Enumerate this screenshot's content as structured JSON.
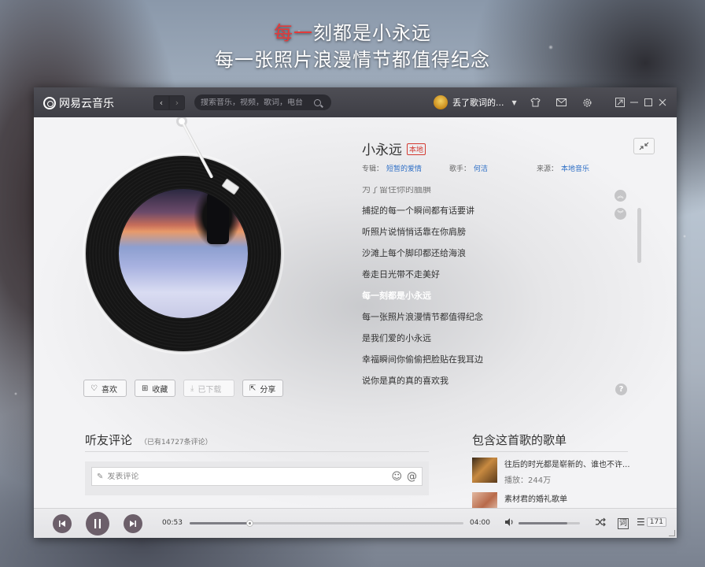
{
  "desktop_lyrics": {
    "line1_highlight": "每一",
    "line1_rest": "刻都是小永远",
    "line2": "每一张照片浪漫情节都值得纪念"
  },
  "titlebar": {
    "app_name": "网易云音乐",
    "back_icon": "‹",
    "forward_icon": "›",
    "search_placeholder": "搜索音乐，视频，歌词，电台",
    "user_name": "丢了歌词的...",
    "caret": "▼"
  },
  "song": {
    "title": "小永远",
    "badge": "本地",
    "album_label": "专辑：",
    "album": "短暂的爱情",
    "artist_label": "歌手：",
    "artist": "何洁",
    "source_label": "来源：",
    "source": "本地音乐"
  },
  "lyrics": {
    "lines": [
      "为了留住你的腼腆",
      "捕捉的每一个瞬间都有话要讲",
      "听照片说悄悄话靠在你肩膀",
      "沙滩上每个脚印都还给海浪",
      "卷走日光带不走美好",
      "每一刻都是小永远",
      "每一张照片浪漫情节都值得纪念",
      "是我们爱的小永远",
      "幸福瞬间你偷偷把脸贴在我耳边",
      "说你是真的真的喜欢我"
    ],
    "active_index": 5,
    "help": "?"
  },
  "actions": {
    "like": "喜欢",
    "collect": "收藏",
    "download": "已下载",
    "share": "分享"
  },
  "comments": {
    "title": "听友评论",
    "count_text": "（已有14727条评论）",
    "input_placeholder": "发表评论"
  },
  "playlists": {
    "title": "包含这首歌的歌单",
    "items": [
      {
        "name": "往后的时光都是崭新的、谁也不许...",
        "plays": "播放：244万"
      },
      {
        "name": "素材君的婚礼歌单",
        "plays": ""
      }
    ]
  },
  "player": {
    "current_time": "00:53",
    "total_time": "04:00",
    "progress": 0.22,
    "volume": 0.8,
    "lyric_btn": "词",
    "playlist_count": "171"
  },
  "colors": {
    "titlebar": "#4e4e55",
    "accent_red": "#d33a31",
    "link_blue": "#2e6fc6",
    "play_btn": "#6c5f6a"
  }
}
